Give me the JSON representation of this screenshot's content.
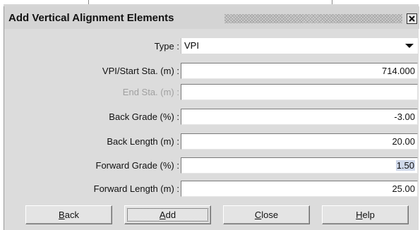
{
  "dialog": {
    "title": "Add Vertical Alignment Elements",
    "close_icon": "close-x-icon"
  },
  "form": {
    "type": {
      "label": "Type :",
      "value": "VPI",
      "icon": "dropdown-caret-icon"
    },
    "start_station": {
      "label": "VPI/Start Sta. (m) :",
      "value": "714.000"
    },
    "end_station": {
      "label": "End Sta. (m) :",
      "value": "",
      "disabled": true
    },
    "back_grade": {
      "label": "Back Grade (%) :",
      "value": "-3.00"
    },
    "back_length": {
      "label": "Back Length (m) :",
      "value": "20.00"
    },
    "forward_grade": {
      "label": "Forward Grade (%) :",
      "value": "1.50"
    },
    "forward_length": {
      "label": "Forward Length (m) :",
      "value": "25.00"
    }
  },
  "buttons": {
    "back": {
      "mnemonic": "B",
      "rest": "ack"
    },
    "add": {
      "mnemonic": "A",
      "rest": "dd"
    },
    "close": {
      "mnemonic": "C",
      "rest": "lose"
    },
    "help": {
      "mnemonic": "H",
      "rest": "elp"
    }
  },
  "colors": {
    "dialog_background": "#dcdcdc",
    "field_background": "#ffffff",
    "selection_highlight": "#cfd8ea",
    "disabled_text": "#a0a0a0"
  }
}
